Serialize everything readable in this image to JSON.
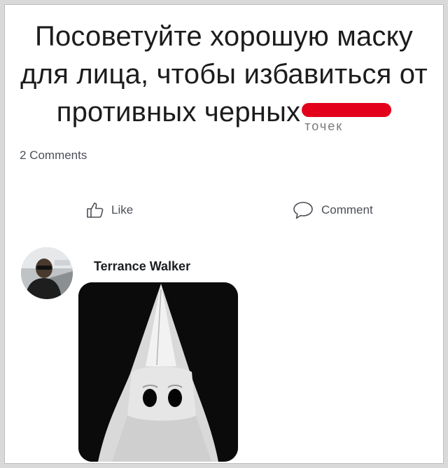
{
  "post": {
    "lines": [
      "Посоветуйте хорошую маску",
      "для лица, чтобы избавиться от",
      "противных черных"
    ],
    "redacted_tail": "точек"
  },
  "stats": {
    "comments": "2 Comments"
  },
  "actions": {
    "like": "Like",
    "comment": "Comment"
  },
  "comment": {
    "author": "Terrance Walker"
  },
  "icons": [
    "thumbs-up-icon",
    "speech-bubble-icon"
  ],
  "colors": {
    "redaction": "#e3001b",
    "text": "#1c1c1c",
    "meta": "#4b4f56"
  }
}
